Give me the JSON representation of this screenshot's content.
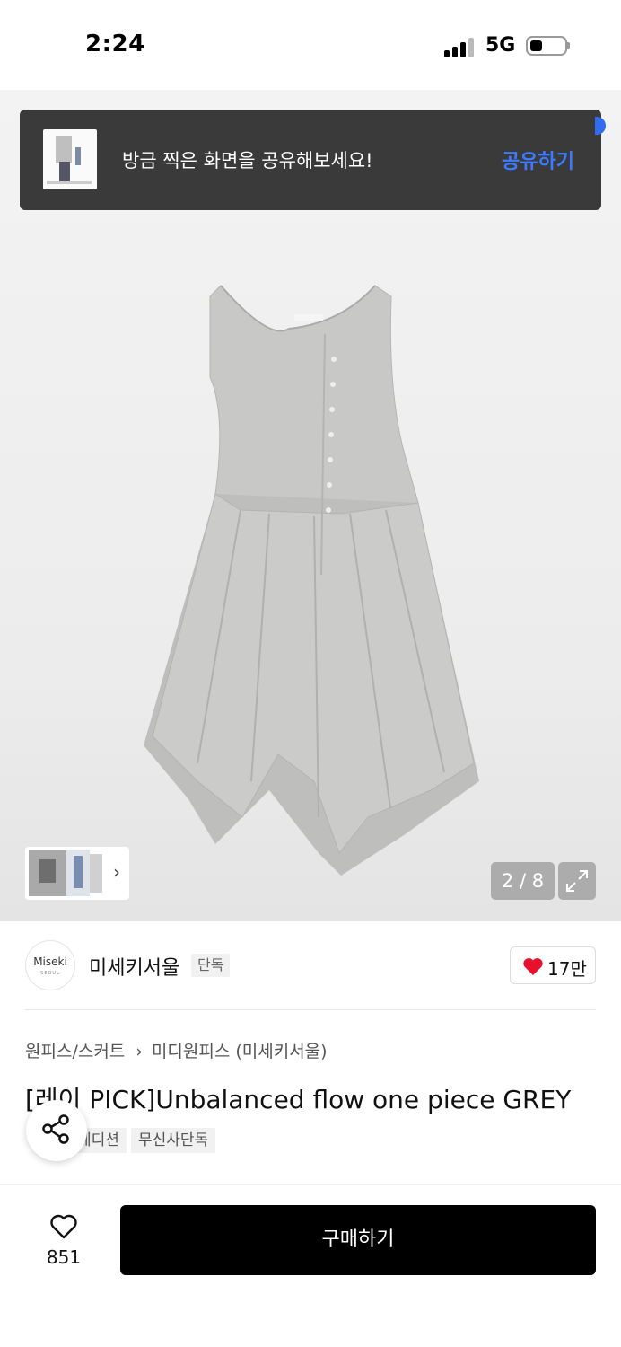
{
  "status_bar": {
    "time": "2:24",
    "network": "5G"
  },
  "share_toast": {
    "message": "방금 찍은 화면을 공유해보세요!",
    "action_label": "공유하기"
  },
  "gallery": {
    "counter": "2 / 8"
  },
  "brand": {
    "logo_text": "Miseki",
    "logo_subtext": "SEOUL",
    "name": "미세키서울",
    "tag": "단독"
  },
  "likes": {
    "count": "17만"
  },
  "breadcrumb": {
    "category": "원피스/스커트",
    "subcategory": "미디원피스 (미세키서울)"
  },
  "product": {
    "title": "[레이 PICK]Unbalanced flow one piece GREY",
    "tags": [
      "에디션",
      "무신사단독"
    ]
  },
  "bottom_bar": {
    "wish_count": "851",
    "buy_label": "구매하기"
  },
  "colors": {
    "accent_blue": "#3b7cff",
    "like_red": "#e8112d",
    "buy_button": "#000000"
  }
}
